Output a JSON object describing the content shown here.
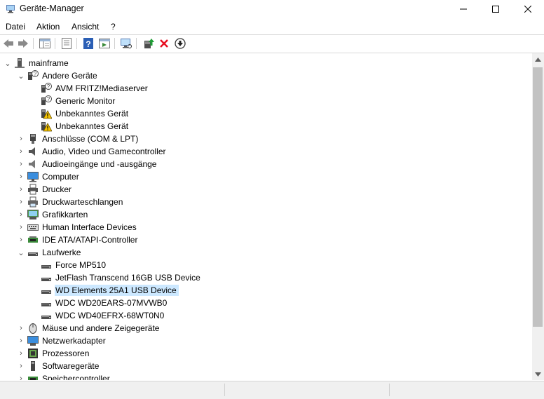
{
  "window": {
    "title": "Geräte-Manager"
  },
  "menu": [
    "Datei",
    "Aktion",
    "Ansicht",
    "?"
  ],
  "toolbar_icons": [
    "back-arrow-icon",
    "forward-arrow-icon",
    "show-hide-tree-icon",
    "properties-icon",
    "help-icon",
    "action-view-icon",
    "scan-hardware-icon",
    "update-driver-icon",
    "uninstall-icon",
    "disable-device-icon"
  ],
  "tree": {
    "root": "mainframe",
    "other_devices": {
      "label": "Andere Geräte",
      "items": [
        "AVM FRITZ!Mediaserver",
        "Generic Monitor",
        "Unbekanntes Gerät",
        "Unbekanntes Gerät"
      ]
    },
    "categories_a": [
      "Anschlüsse (COM & LPT)",
      "Audio, Video und Gamecontroller",
      "Audioeingänge und -ausgänge",
      "Computer",
      "Drucker",
      "Druckwarteschlangen",
      "Grafikkarten",
      "Human Interface Devices",
      "IDE ATA/ATAPI-Controller"
    ],
    "drives": {
      "label": "Laufwerke",
      "items": [
        "Force MP510",
        "JetFlash Transcend 16GB USB Device",
        "WD Elements 25A1 USB Device",
        "WDC WD20EARS-07MVWB0",
        "WDC WD40EFRX-68WT0N0"
      ],
      "selected_index": 2
    },
    "categories_b": [
      "Mäuse und andere Zeigegeräte",
      "Netzwerkadapter",
      "Prozessoren",
      "Softwaregeräte",
      "Speichercontroller"
    ]
  },
  "colors": {
    "selection": "#cce8ff",
    "warning": "#f5c400",
    "uninstall_red": "#e81123"
  }
}
